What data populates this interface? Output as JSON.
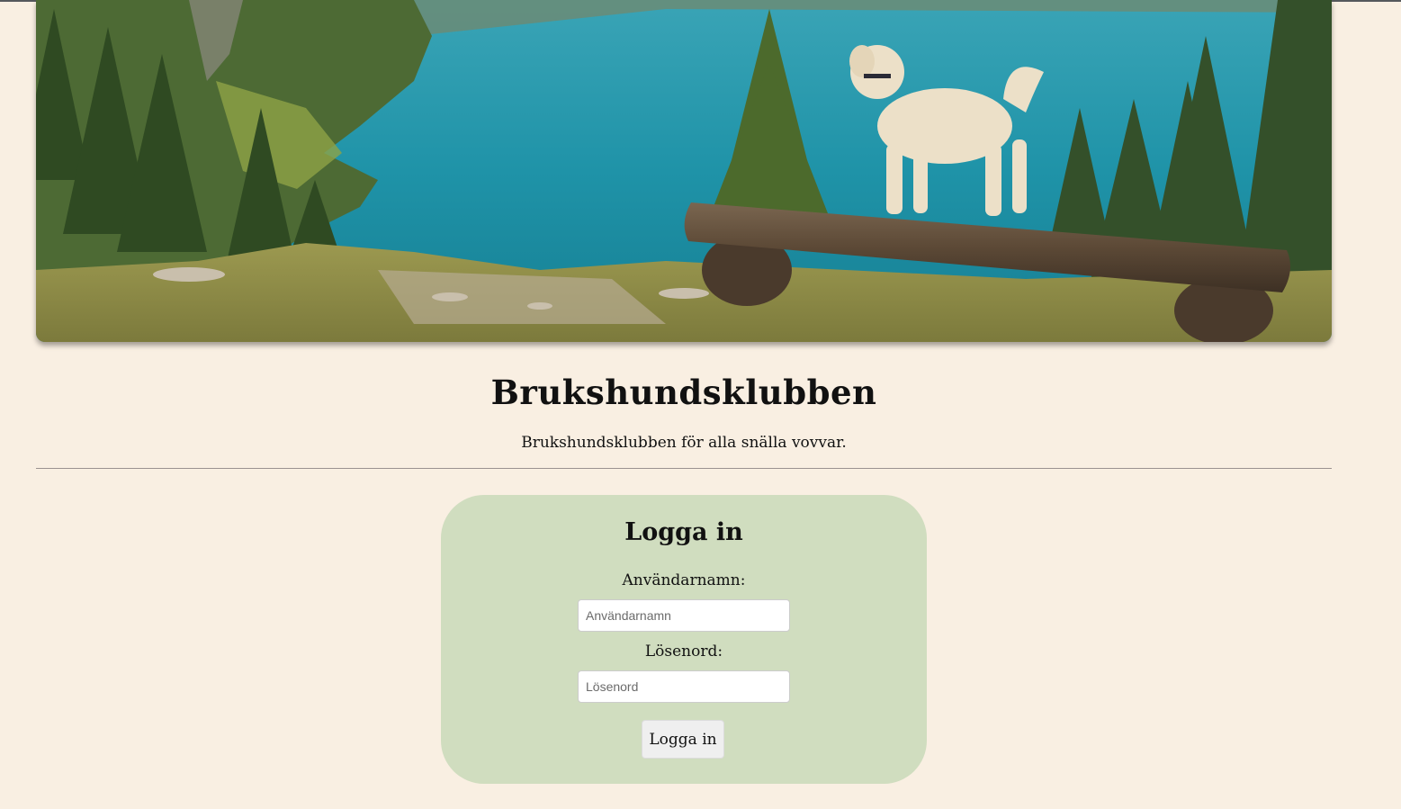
{
  "hero": {
    "image": "dog-standing-on-log-bench-by-mountain-lake",
    "colors": {
      "lake": "#1f9bb0",
      "forest": "#3f5a2a",
      "grass": "#a7a04c",
      "log": "#5a4734",
      "dog": "#ece0c8"
    }
  },
  "site": {
    "title": "Brukshundsklubben",
    "tagline": "Brukshundsklubben för alla snälla vovvar."
  },
  "login": {
    "title": "Logga in",
    "username_label": "Användarnamn:",
    "username_placeholder": "Användarnamn",
    "username_value": "",
    "password_label": "Lösenord:",
    "password_placeholder": "Lösenord",
    "password_value": "",
    "submit_label": "Logga in"
  },
  "colors": {
    "page_background": "#f9efe2",
    "card_background": "#d0ddbf",
    "divider": "#9a9290"
  }
}
